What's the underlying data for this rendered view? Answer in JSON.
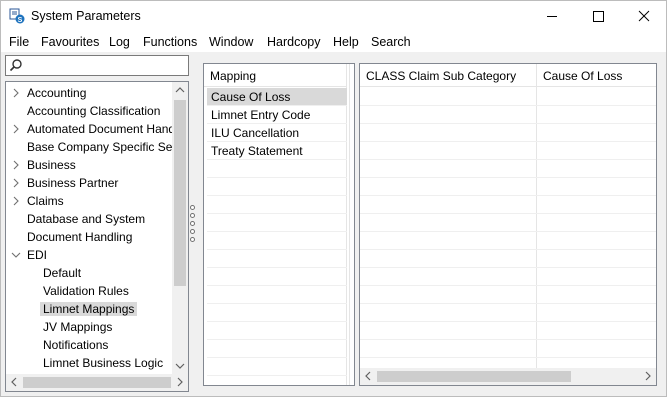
{
  "window": {
    "title": "System Parameters"
  },
  "menu": [
    "File",
    "Favourites",
    "Log",
    "Functions",
    "Window",
    "Hardcopy",
    "Help",
    "Search"
  ],
  "search": {
    "value": "",
    "placeholder": ""
  },
  "tree": [
    {
      "label": "Accounting",
      "level": 0,
      "expander": "collapsed",
      "selected": false
    },
    {
      "label": "Accounting Classification",
      "level": 0,
      "expander": "none",
      "selected": false
    },
    {
      "label": "Automated Document Handling",
      "level": 0,
      "expander": "collapsed",
      "selected": false
    },
    {
      "label": "Base Company Specific Settings",
      "level": 0,
      "expander": "none",
      "selected": false
    },
    {
      "label": "Business",
      "level": 0,
      "expander": "collapsed",
      "selected": false
    },
    {
      "label": "Business Partner",
      "level": 0,
      "expander": "collapsed",
      "selected": false
    },
    {
      "label": "Claims",
      "level": 0,
      "expander": "collapsed",
      "selected": false
    },
    {
      "label": "Database and System",
      "level": 0,
      "expander": "none",
      "selected": false
    },
    {
      "label": "Document Handling",
      "level": 0,
      "expander": "none",
      "selected": false
    },
    {
      "label": "EDI",
      "level": 0,
      "expander": "expanded",
      "selected": false
    },
    {
      "label": "Default",
      "level": 1,
      "expander": "none",
      "selected": false
    },
    {
      "label": "Validation Rules",
      "level": 1,
      "expander": "none",
      "selected": false
    },
    {
      "label": "Limnet Mappings",
      "level": 1,
      "expander": "none",
      "selected": true
    },
    {
      "label": "JV Mappings",
      "level": 1,
      "expander": "none",
      "selected": false
    },
    {
      "label": "Notifications",
      "level": 1,
      "expander": "none",
      "selected": false
    },
    {
      "label": "Limnet Business Logic",
      "level": 1,
      "expander": "none",
      "selected": false
    }
  ],
  "mapping": {
    "header": "Mapping",
    "items": [
      {
        "label": "Cause Of Loss",
        "selected": true
      },
      {
        "label": "Limnet Entry Code",
        "selected": false
      },
      {
        "label": "ILU Cancellation",
        "selected": false
      },
      {
        "label": "Treaty Statement",
        "selected": false
      }
    ]
  },
  "detail": {
    "columns": [
      "CLASS Claim Sub Category",
      "Cause Of Loss"
    ]
  }
}
